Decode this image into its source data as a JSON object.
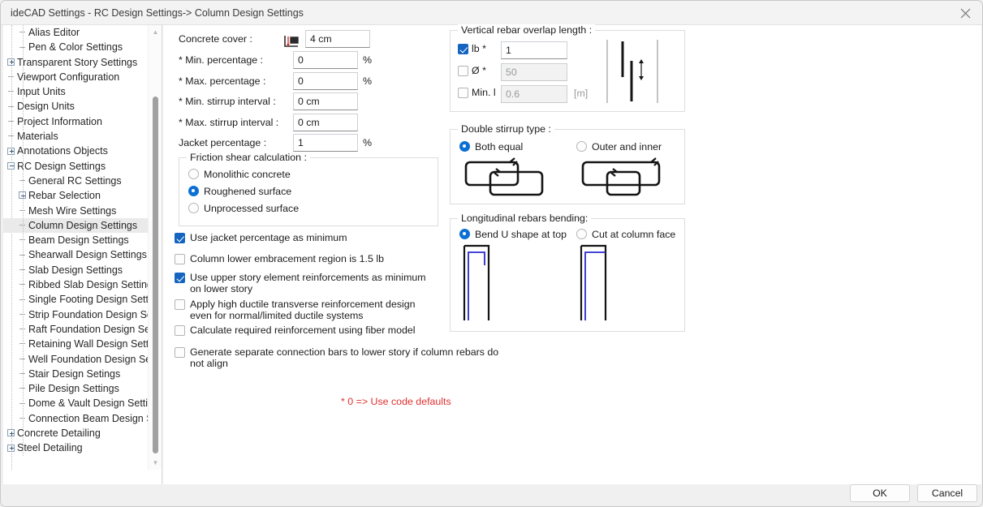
{
  "window": {
    "title": "ideCAD Settings - RC Design Settings-> Column Design Settings",
    "close_icon": "close-icon"
  },
  "sidebar": {
    "items": [
      {
        "label": "Alias Editor",
        "level": 1,
        "marker": "elbow",
        "selected": false
      },
      {
        "label": "Pen & Color Settings",
        "level": 1,
        "marker": "elbow-last",
        "selected": false
      },
      {
        "label": "Transparent Story Settings",
        "level": 0,
        "marker": "plus",
        "selected": false
      },
      {
        "label": "Viewport Configuration",
        "level": 0,
        "marker": "elbow",
        "selected": false
      },
      {
        "label": "Input Units",
        "level": 0,
        "marker": "elbow",
        "selected": false
      },
      {
        "label": "Design Units",
        "level": 0,
        "marker": "elbow",
        "selected": false
      },
      {
        "label": "Project Information",
        "level": 0,
        "marker": "elbow",
        "selected": false
      },
      {
        "label": "Materials",
        "level": 0,
        "marker": "elbow",
        "selected": false
      },
      {
        "label": "Annotations Objects",
        "level": 0,
        "marker": "plus",
        "selected": false
      },
      {
        "label": "RC Design Settings",
        "level": 0,
        "marker": "minus",
        "selected": false
      },
      {
        "label": "General RC Settings",
        "level": 1,
        "marker": "elbow",
        "selected": false
      },
      {
        "label": "Rebar Selection",
        "level": 1,
        "marker": "plus",
        "selected": false
      },
      {
        "label": "Mesh Wire Settings",
        "level": 1,
        "marker": "elbow",
        "selected": false
      },
      {
        "label": "Column Design Settings",
        "level": 1,
        "marker": "elbow",
        "selected": true
      },
      {
        "label": "Beam Design Settings",
        "level": 1,
        "marker": "elbow",
        "selected": false
      },
      {
        "label": "Shearwall Design Settings",
        "level": 1,
        "marker": "elbow",
        "selected": false
      },
      {
        "label": "Slab Design Settings",
        "level": 1,
        "marker": "elbow",
        "selected": false
      },
      {
        "label": "Ribbed Slab Design Settings",
        "level": 1,
        "marker": "elbow",
        "selected": false
      },
      {
        "label": "Single Footing Design Settin",
        "level": 1,
        "marker": "elbow",
        "selected": false
      },
      {
        "label": "Strip Foundation Design Set",
        "level": 1,
        "marker": "elbow",
        "selected": false
      },
      {
        "label": "Raft Foundation Design Sett",
        "level": 1,
        "marker": "elbow",
        "selected": false
      },
      {
        "label": "Retaining Wall Design Settin",
        "level": 1,
        "marker": "elbow",
        "selected": false
      },
      {
        "label": "Well Foundation Design Sett",
        "level": 1,
        "marker": "elbow",
        "selected": false
      },
      {
        "label": "Stair Design Setings",
        "level": 1,
        "marker": "elbow",
        "selected": false
      },
      {
        "label": "Pile Design Settings",
        "level": 1,
        "marker": "elbow",
        "selected": false
      },
      {
        "label": "Dome & Vault Design Settin",
        "level": 1,
        "marker": "elbow",
        "selected": false
      },
      {
        "label": "Connection Beam Design Se",
        "level": 1,
        "marker": "elbow-last",
        "selected": false
      },
      {
        "label": "Concrete Detailing",
        "level": 0,
        "marker": "plus",
        "selected": false
      },
      {
        "label": "Steel Detailing",
        "level": 0,
        "marker": "plus",
        "selected": false
      }
    ]
  },
  "form": {
    "concrete_cover": {
      "label": "Concrete cover :",
      "value": "4 cm",
      "icon": "concrete-cover-icon"
    },
    "min_percentage": {
      "label": "* Min. percentage :",
      "value": "0",
      "unit": "%"
    },
    "max_percentage": {
      "label": "* Max. percentage :",
      "value": "0",
      "unit": "%"
    },
    "min_stirrup_interval": {
      "label": "* Min. stirrup interval :",
      "value": "0 cm"
    },
    "max_stirrup_interval": {
      "label": "* Max. stirrup interval :",
      "value": "0 cm"
    },
    "jacket_percentage": {
      "label": "Jacket percentage :",
      "value": "1",
      "unit": "%"
    }
  },
  "friction_shear": {
    "title": "Friction shear calculation :",
    "options": [
      {
        "label": "Monolithic concrete",
        "selected": false
      },
      {
        "label": "Roughened surface",
        "selected": true
      },
      {
        "label": "Unprocessed surface",
        "selected": false
      }
    ]
  },
  "checkboxes": [
    {
      "label": "Use jacket percentage as minimum",
      "checked": true
    },
    {
      "label": "Column lower embracement region is 1.5 lb",
      "checked": false
    },
    {
      "label": "Use upper story element reinforcements as minimum on lower story",
      "checked": true
    },
    {
      "label": "Apply high ductile transverse reinforcement design even for normal/limited ductile systems",
      "checked": false
    },
    {
      "label": "Calculate required reinforcement using fiber model",
      "checked": false
    },
    {
      "label": "Generate separate connection bars to lower story if column rebars do not align",
      "checked": false
    }
  ],
  "note": "* 0 => Use code defaults",
  "vertical_overlap": {
    "title": "Vertical rebar overlap length :",
    "rows": [
      {
        "label": "lb *",
        "checked": true,
        "value": "1",
        "disabled": false,
        "unit": ""
      },
      {
        "label": "Ø *",
        "checked": false,
        "value": "50",
        "disabled": true,
        "unit": ""
      },
      {
        "label": "Min. l",
        "checked": false,
        "value": "0.6",
        "disabled": true,
        "unit": "[m]"
      }
    ]
  },
  "double_stirrup": {
    "title": "Double stirrup type :",
    "options": [
      {
        "label": "Both equal",
        "selected": true
      },
      {
        "label": "Outer and inner",
        "selected": false
      }
    ]
  },
  "rebar_bending": {
    "title": "Longitudinal rebars bending:",
    "options": [
      {
        "label": "Bend U shape at top",
        "selected": true
      },
      {
        "label": "Cut at column face",
        "selected": false
      }
    ]
  },
  "footer": {
    "ok_label": "OK",
    "cancel_label": "Cancel"
  },
  "colors": {
    "accent": "#0b6fd4",
    "checkbox": "#1565c0",
    "note": "#e03030",
    "rebar_blue": "#2a2ad0"
  }
}
